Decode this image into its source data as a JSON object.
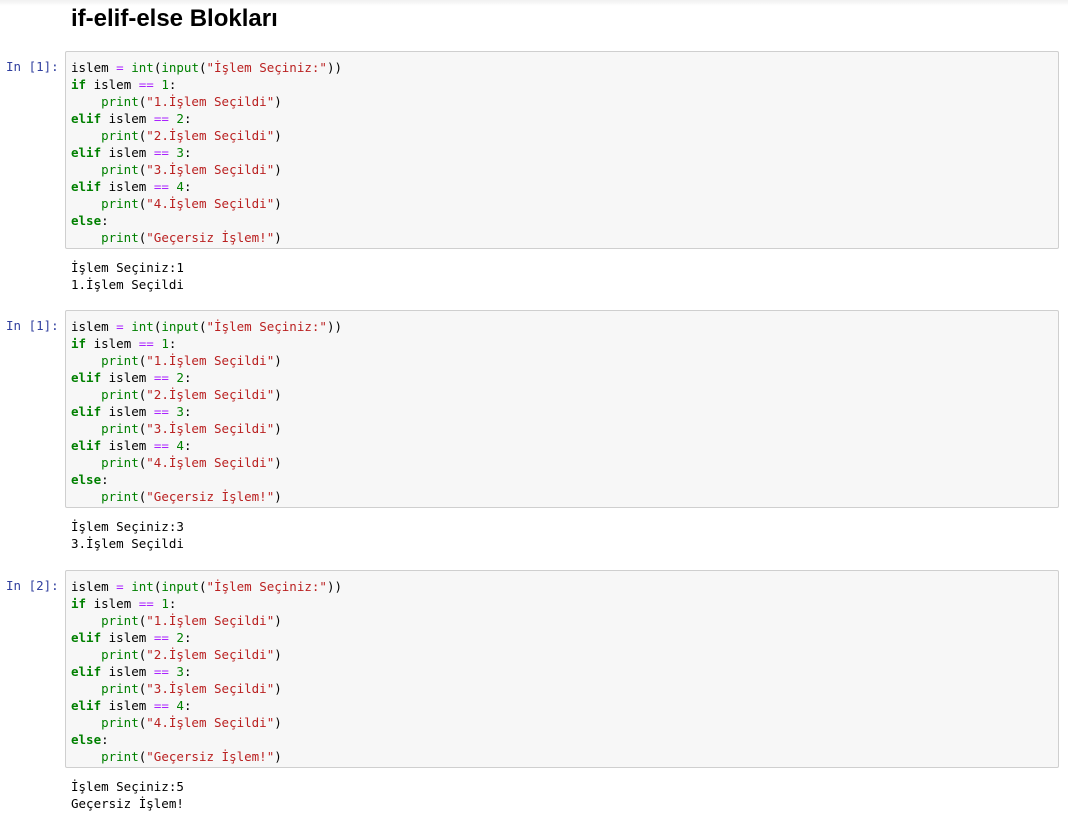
{
  "heading": "if-elif-else Blokları",
  "cells": [
    {
      "prompt": "In [1]:",
      "code": {
        "var": "islem",
        "assign": "=",
        "int_fn": "int",
        "input_fn": "input",
        "input_prompt": "\"İşlem Seçiniz:\"",
        "conditions": [
          {
            "keyword": "if",
            "value": "1",
            "message": "\"1.İşlem Seçildi\""
          },
          {
            "keyword": "elif",
            "value": "2",
            "message": "\"2.İşlem Seçildi\""
          },
          {
            "keyword": "elif",
            "value": "3",
            "message": "\"3.İşlem Seçildi\""
          },
          {
            "keyword": "elif",
            "value": "4",
            "message": "\"4.İşlem Seçildi\""
          }
        ],
        "else_keyword": "else",
        "else_message": "\"Geçersiz İşlem!\""
      },
      "output": [
        "İşlem Seçiniz:1",
        "1.İşlem Seçildi"
      ]
    },
    {
      "prompt": "In [1]:",
      "code": {
        "var": "islem",
        "assign": "=",
        "int_fn": "int",
        "input_fn": "input",
        "input_prompt": "\"İşlem Seçiniz:\"",
        "conditions": [
          {
            "keyword": "if",
            "value": "1",
            "message": "\"1.İşlem Seçildi\""
          },
          {
            "keyword": "elif",
            "value": "2",
            "message": "\"2.İşlem Seçildi\""
          },
          {
            "keyword": "elif",
            "value": "3",
            "message": "\"3.İşlem Seçildi\""
          },
          {
            "keyword": "elif",
            "value": "4",
            "message": "\"4.İşlem Seçildi\""
          }
        ],
        "else_keyword": "else",
        "else_message": "\"Geçersiz İşlem!\""
      },
      "output": [
        "İşlem Seçiniz:3",
        "3.İşlem Seçildi"
      ]
    },
    {
      "prompt": "In [2]:",
      "code": {
        "var": "islem",
        "assign": "=",
        "int_fn": "int",
        "input_fn": "input",
        "input_prompt": "\"İşlem Seçiniz:\"",
        "conditions": [
          {
            "keyword": "if",
            "value": "1",
            "message": "\"1.İşlem Seçildi\""
          },
          {
            "keyword": "elif",
            "value": "2",
            "message": "\"2.İşlem Seçildi\""
          },
          {
            "keyword": "elif",
            "value": "3",
            "message": "\"3.İşlem Seçildi\""
          },
          {
            "keyword": "elif",
            "value": "4",
            "message": "\"4.İşlem Seçildi\""
          }
        ],
        "else_keyword": "else",
        "else_message": "\"Geçersiz İşlem!\""
      },
      "output": [
        "İşlem Seçiniz:5",
        "Geçersiz İşlem!"
      ]
    }
  ]
}
